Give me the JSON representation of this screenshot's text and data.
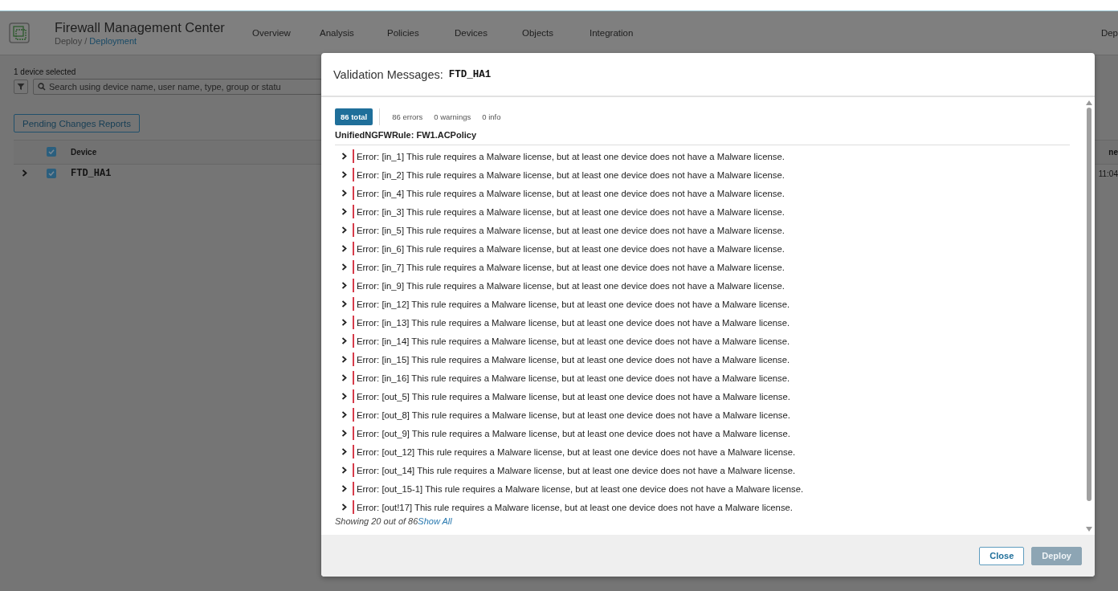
{
  "app": {
    "title": "Firewall Management Center",
    "breadcrumb": {
      "parent": "Deploy /",
      "current": "Deployment"
    },
    "nav": [
      {
        "label": "Overview"
      },
      {
        "label": "Analysis"
      },
      {
        "label": "Policies"
      },
      {
        "label": "Devices"
      },
      {
        "label": "Objects"
      },
      {
        "label": "Integration"
      }
    ],
    "nav_right": "Dep"
  },
  "deploy_panel": {
    "selection": "1 device selected",
    "search": {
      "placeholder": "Search using device name, user name, type, group or statu"
    },
    "reports_button": "Pending Changes Reports",
    "table": {
      "columns": [
        "Device"
      ],
      "header_checked": true,
      "column_cut": "ne",
      "rows": [
        {
          "device": "FTD_HA1",
          "checked": true,
          "expanded": false,
          "cell_cut": "11:04"
        }
      ]
    }
  },
  "dialog": {
    "title": "Validation Messages:",
    "device": "FTD_HA1",
    "tabs": [
      {
        "label": "86 total",
        "selected": true
      },
      {
        "label": "86 errors",
        "selected": false
      },
      {
        "label": "0 warnings",
        "selected": false
      },
      {
        "label": "0 info",
        "selected": false
      }
    ],
    "group": "UnifiedNGFWRule: FW1.ACPolicy",
    "messages": [
      {
        "text": "Error: [in_1] This rule requires a Malware license, but at least one device does not have a Malware license.",
        "expanded": false
      },
      {
        "text": "Error: [in_2] This rule requires a Malware license, but at least one device does not have a Malware license.",
        "expanded": false
      },
      {
        "text": "Error: [in_4] This rule requires a Malware license, but at least one device does not have a Malware license.",
        "expanded": false
      },
      {
        "text": "Error: [in_3] This rule requires a Malware license, but at least one device does not have a Malware license.",
        "expanded": false
      },
      {
        "text": "Error: [in_5] This rule requires a Malware license, but at least one device does not have a Malware license.",
        "expanded": false
      },
      {
        "text": "Error: [in_6] This rule requires a Malware license, but at least one device does not have a Malware license.",
        "expanded": false
      },
      {
        "text": "Error: [in_7] This rule requires a Malware license, but at least one device does not have a Malware license.",
        "expanded": false
      },
      {
        "text": "Error: [in_9] This rule requires a Malware license, but at least one device does not have a Malware license.",
        "expanded": false
      },
      {
        "text": "Error: [in_12] This rule requires a Malware license, but at least one device does not have a Malware license.",
        "expanded": false
      },
      {
        "text": "Error: [in_13] This rule requires a Malware license, but at least one device does not have a Malware license.",
        "expanded": false
      },
      {
        "text": "Error: [in_14] This rule requires a Malware license, but at least one device does not have a Malware license.",
        "expanded": false
      },
      {
        "text": "Error: [in_15] This rule requires a Malware license, but at least one device does not have a Malware license.",
        "expanded": false
      },
      {
        "text": "Error: [in_16] This rule requires a Malware license, but at least one device does not have a Malware license.",
        "expanded": false
      },
      {
        "text": "Error: [out_5] This rule requires a Malware license, but at least one device does not have a Malware license.",
        "expanded": false
      },
      {
        "text": "Error: [out_8] This rule requires a Malware license, but at least one device does not have a Malware license.",
        "expanded": false
      },
      {
        "text": "Error: [out_9] This rule requires a Malware license, but at least one device does not have a Malware license.",
        "expanded": false
      },
      {
        "text": "Error: [out_12] This rule requires a Malware license, but at least one device does not have a Malware license.",
        "expanded": false
      },
      {
        "text": "Error: [out_14] This rule requires a Malware license, but at least one device does not have a Malware license.",
        "expanded": false
      },
      {
        "text": "Error: [out_15-1] This rule requires a Malware license, but at least one device does not have a Malware license.",
        "expanded": false
      },
      {
        "text": "Error: [out!17] This rule requires a Malware license, but at least one device does not have a Malware license.",
        "expanded": false
      }
    ],
    "summary": "Showing 20 out of 86",
    "show_all": "Show All",
    "buttons": [
      {
        "label": "Close",
        "kind": "secondary",
        "disabled": false
      },
      {
        "label": "Deploy",
        "kind": "primary",
        "disabled": true
      }
    ]
  }
}
